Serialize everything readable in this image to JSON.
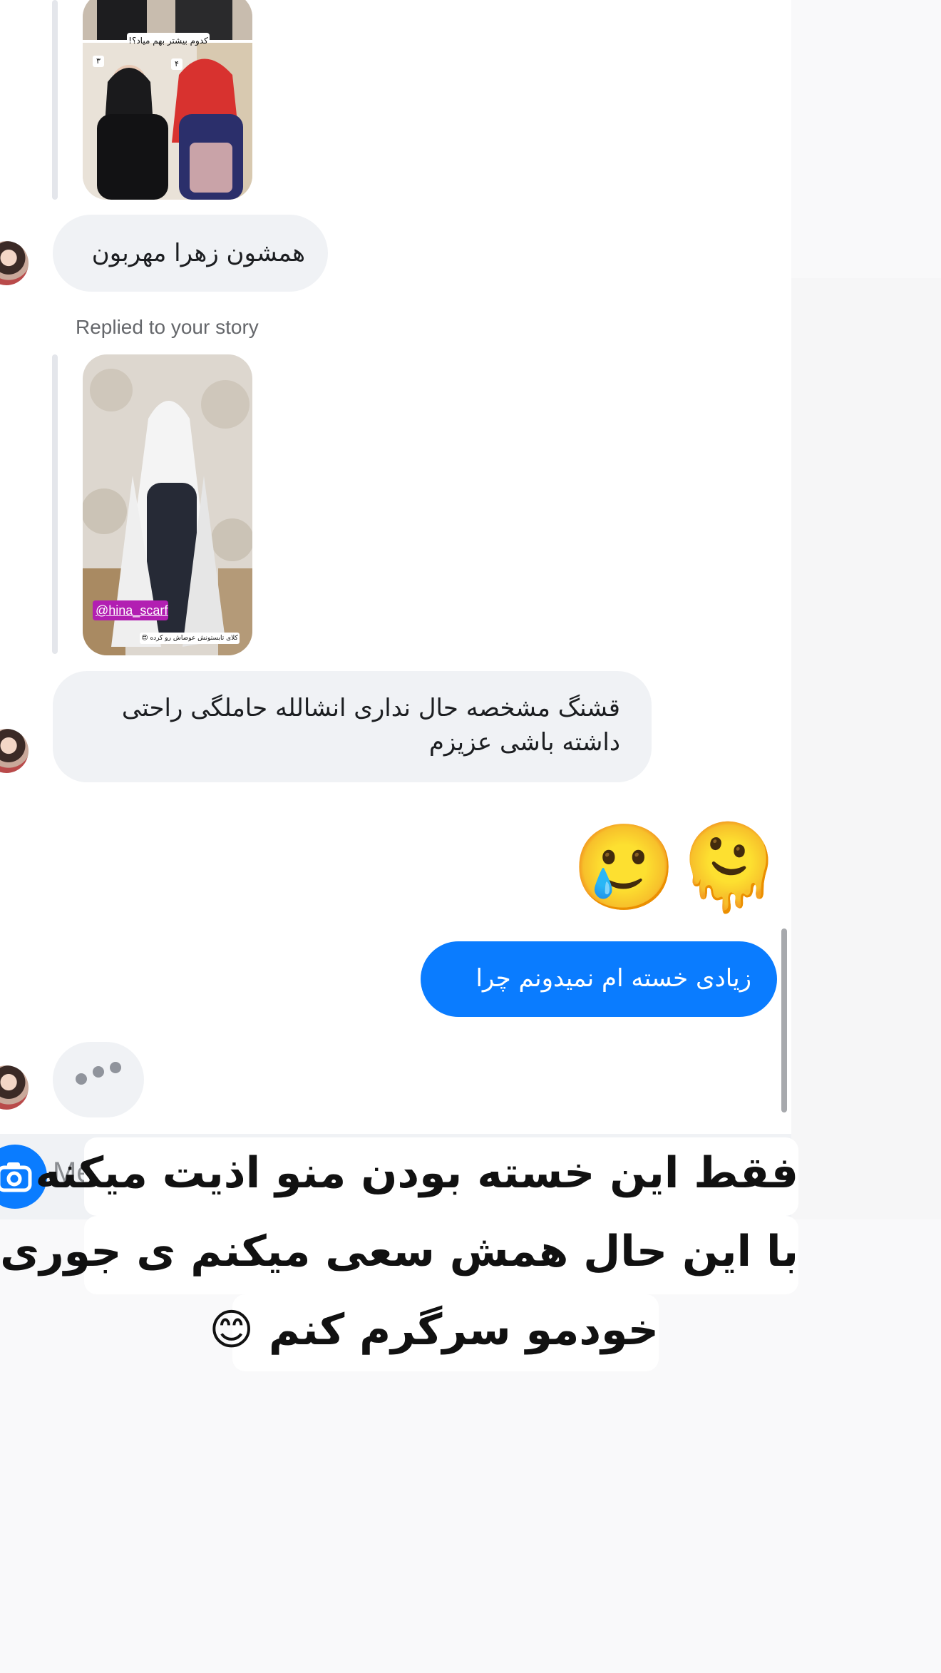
{
  "messages": {
    "received_1": "همشون زهرا مهربون",
    "replied_label": "Replied to your story",
    "story_tag": "@hina_scarf",
    "story_caption": "کلای تابستونش عوضاش رو کرده 😍",
    "received_2_line1": "قشنگ مشخصه حال نداری انشالله حاملگی راحتی",
    "received_2_line2": "داشته باشی عزیزم",
    "emojis": "🥲🫠",
    "sent_1": "زیادی خسته ام نمیدونم چرا"
  },
  "top_story": {
    "question": "کدوم بیشتر بهم میاد؟!",
    "option_left": "۳",
    "option_right": "۴"
  },
  "composer": {
    "placeholder": "Me"
  },
  "overlay_caption": {
    "line1": "فقط این خسته بودن منو اذیت میکنه",
    "line2": "با این حال همش سعی میکنم ی جوری",
    "line3": "خودمو سرگرم کنم 😊"
  },
  "colors": {
    "sent_bubble": "#0a7cff",
    "received_bubble": "#f0f2f5",
    "background": "#ffffff"
  }
}
